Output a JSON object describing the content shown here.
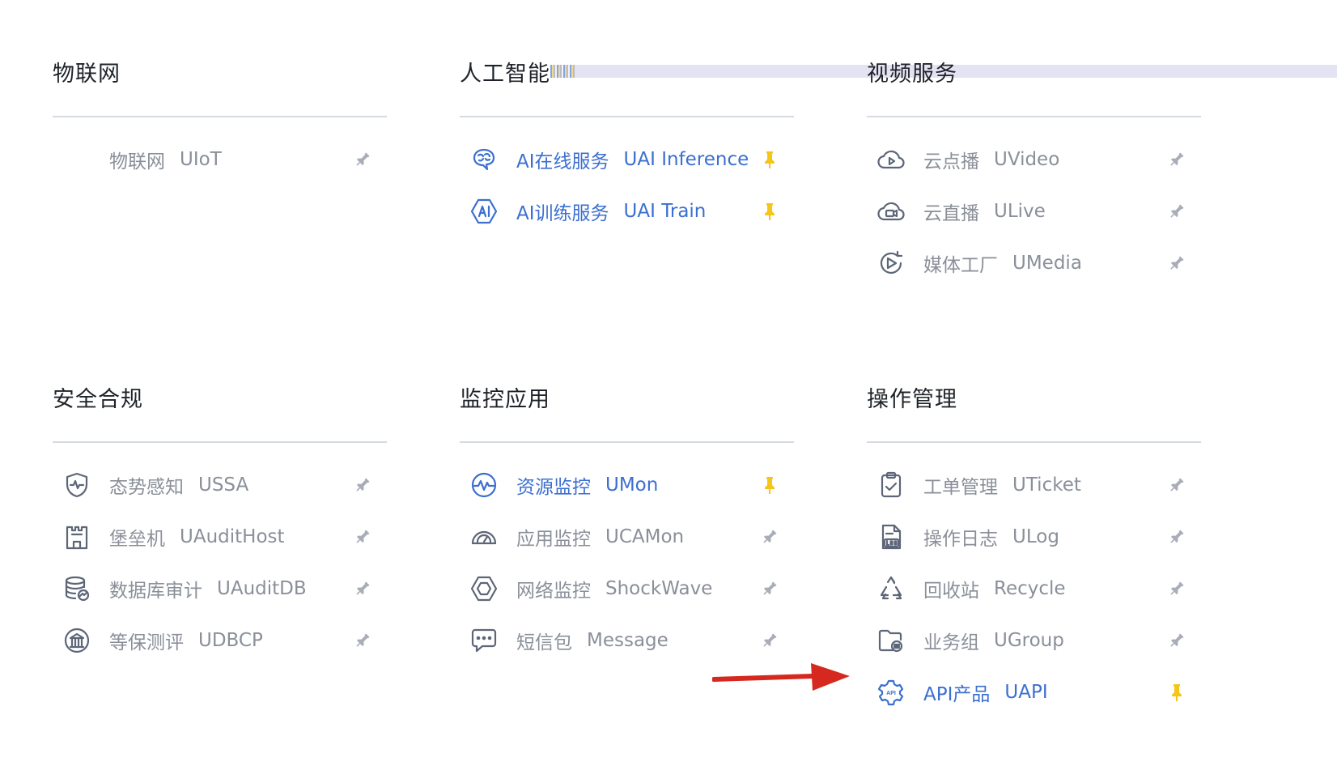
{
  "colors": {
    "active_text": "#3b6fd0",
    "inactive_text": "#8a8f99",
    "title_text": "#1f2329",
    "pin_pinned": "#f5c518",
    "pin_unpinned": "#a8adb8",
    "divider": "#d5d9e2",
    "arrow": "#d5291f"
  },
  "sections": [
    {
      "title": "物联网",
      "items": [
        {
          "label": "物联网",
          "code": "UIoT",
          "icon": "none",
          "pinned": false
        }
      ]
    },
    {
      "title": "人工智能",
      "items": [
        {
          "label": "AI在线服务",
          "code": "UAI Inference",
          "icon": "brain-icon",
          "pinned": true
        },
        {
          "label": "AI训练服务",
          "code": "UAI Train",
          "icon": "ai-hexagon-icon",
          "pinned": true
        }
      ]
    },
    {
      "title": "视频服务",
      "items": [
        {
          "label": "云点播",
          "code": "UVideo",
          "icon": "cloud-play-icon",
          "pinned": false
        },
        {
          "label": "云直播",
          "code": "ULive",
          "icon": "cloud-camera-icon",
          "pinned": false
        },
        {
          "label": "媒体工厂",
          "code": "UMedia",
          "icon": "media-play-icon",
          "pinned": false
        }
      ]
    },
    {
      "title": "安全合规",
      "items": [
        {
          "label": "态势感知",
          "code": "USSA",
          "icon": "shield-pulse-icon",
          "pinned": false
        },
        {
          "label": "堡垒机",
          "code": "UAuditHost",
          "icon": "castle-icon",
          "pinned": false
        },
        {
          "label": "数据库审计",
          "code": "UAuditDB",
          "icon": "database-check-icon",
          "pinned": false
        },
        {
          "label": "等保测评",
          "code": "UDBCP",
          "icon": "bank-icon",
          "pinned": false
        }
      ]
    },
    {
      "title": "监控应用",
      "items": [
        {
          "label": "资源监控",
          "code": "UMon",
          "icon": "pulse-circle-icon",
          "pinned": true
        },
        {
          "label": "应用监控",
          "code": "UCAMon",
          "icon": "gauge-icon",
          "pinned": false
        },
        {
          "label": "网络监控",
          "code": "ShockWave",
          "icon": "network-hexagon-icon",
          "pinned": false
        },
        {
          "label": "短信包",
          "code": "Message",
          "icon": "message-icon",
          "pinned": false
        }
      ]
    },
    {
      "title": "操作管理",
      "items": [
        {
          "label": "工单管理",
          "code": "UTicket",
          "icon": "clipboard-check-icon",
          "pinned": false
        },
        {
          "label": "操作日志",
          "code": "ULog",
          "icon": "log-file-icon",
          "pinned": false
        },
        {
          "label": "回收站",
          "code": "Recycle",
          "icon": "recycle-icon",
          "pinned": false
        },
        {
          "label": "业务组",
          "code": "UGroup",
          "icon": "group-folder-icon",
          "pinned": false
        },
        {
          "label": "API产品",
          "code": "UAPI",
          "icon": "api-gear-icon",
          "pinned": true
        }
      ]
    }
  ]
}
